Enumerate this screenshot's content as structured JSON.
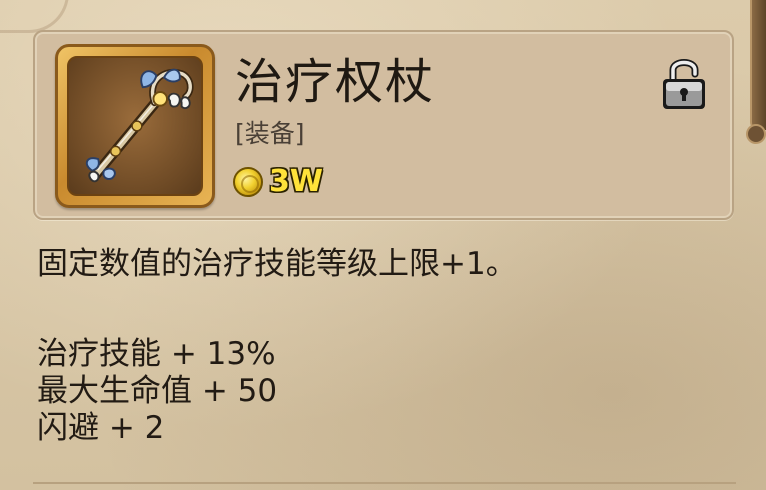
{
  "item": {
    "name": "治疗权杖",
    "type": "[装备]",
    "price": "3W",
    "icon": "staff-icon",
    "locked": false
  },
  "description": "固定数值的治疗技能等级上限+1。",
  "stats": [
    {
      "text": "治疗技能 + 13%"
    },
    {
      "text": "最大生命值 + 50"
    },
    {
      "text": "闪避 + 2"
    }
  ],
  "icons": {
    "lock": "unlocked-padlock-icon",
    "currency": "gold-coin-icon"
  },
  "colors": {
    "background": "#d6c5a6",
    "panel": "#d2bda0",
    "frame_gold": "#c98a2e",
    "price_text": "#ffe23a"
  }
}
